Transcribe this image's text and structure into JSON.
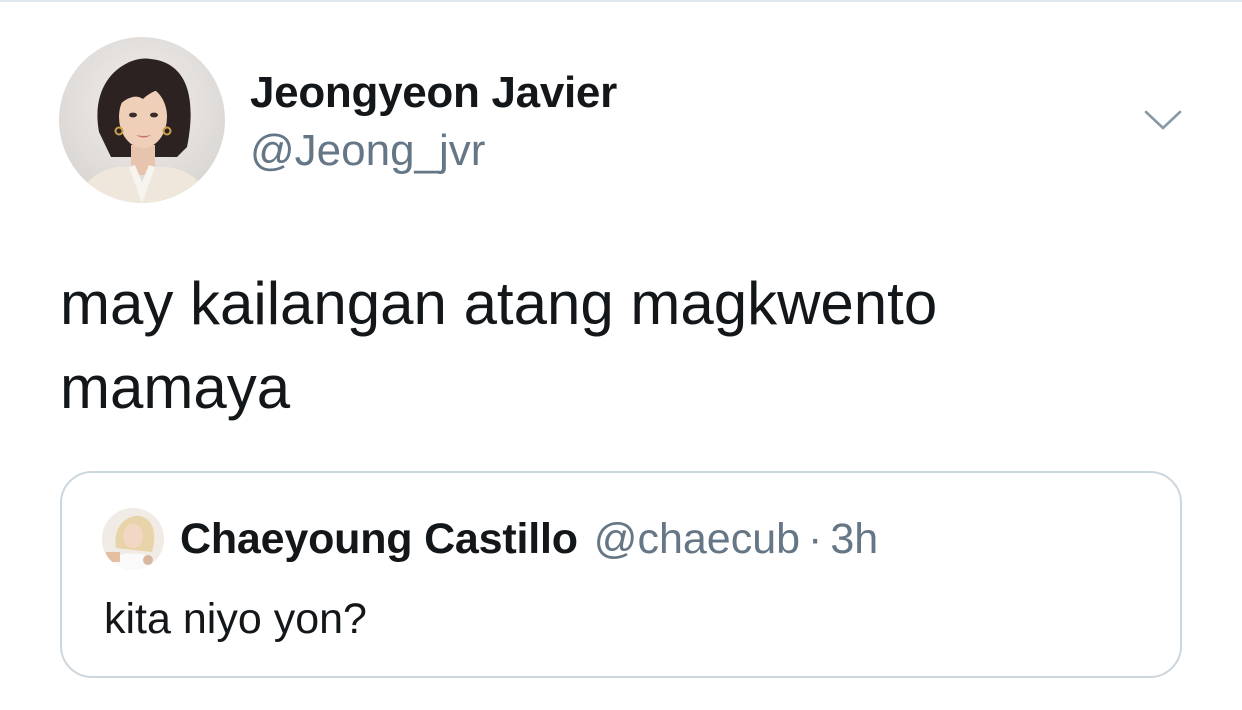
{
  "tweet": {
    "author": {
      "name": "Jeongyeon Javier",
      "handle": "@Jeong_jvr",
      "avatar_icon": "profile-photo"
    },
    "menu_icon": "chevron-down-icon",
    "text_lines": [
      "may kailangan atang magkwento",
      "mamaya"
    ]
  },
  "quoted_tweet": {
    "author": {
      "name": "Chaeyoung Castillo",
      "handle": "@chaecub",
      "avatar_icon": "profile-photo"
    },
    "separator": "·",
    "time": "3h",
    "text": "kita niyo yon?"
  },
  "colors": {
    "text_primary": "#14171a",
    "text_secondary": "#657786",
    "border": "#ccd6dd",
    "chevron": "#8899a6"
  }
}
